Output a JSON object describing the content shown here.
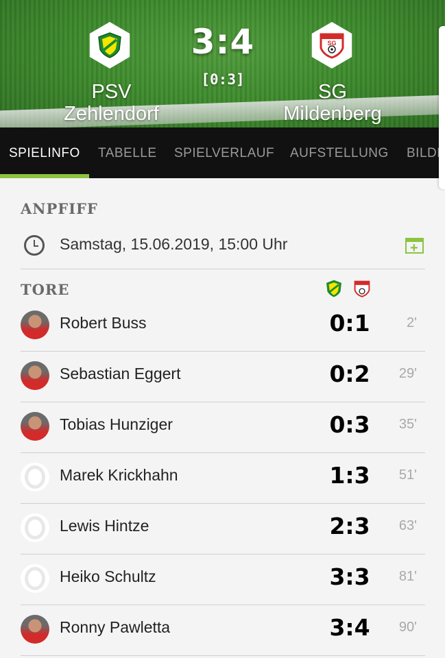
{
  "match": {
    "home_team": [
      "PSV",
      "Zehlendorf"
    ],
    "away_team": [
      "SG",
      "Mildenberg"
    ],
    "score": "3:4",
    "halftime": "[0:3]"
  },
  "tabs": [
    {
      "label": "SPIELINFO",
      "active": true
    },
    {
      "label": "TABELLE",
      "active": false
    },
    {
      "label": "SPIELVERLAUF",
      "active": false
    },
    {
      "label": "AUFSTELLUNG",
      "active": false
    },
    {
      "label": "BILDE",
      "active": false
    }
  ],
  "kickoff": {
    "title": "ANPFIFF",
    "datetime": "Samstag, 15.06.2019, 15:00 Uhr",
    "icon": "clock-icon",
    "action_icon": "calendar-add-icon"
  },
  "goals_section": {
    "title": "TORE",
    "goals": [
      {
        "player": "Robert Buss",
        "score": "0:1",
        "minute": "2'",
        "avatar": "photo"
      },
      {
        "player": "Sebastian Eggert",
        "score": "0:2",
        "minute": "29'",
        "avatar": "photo"
      },
      {
        "player": "Tobias Hunziger",
        "score": "0:3",
        "minute": "35'",
        "avatar": "photo"
      },
      {
        "player": "Marek Krickhahn",
        "score": "1:3",
        "minute": "51'",
        "avatar": "placeholder"
      },
      {
        "player": "Lewis Hintze",
        "score": "2:3",
        "minute": "63'",
        "avatar": "placeholder"
      },
      {
        "player": "Heiko Schultz",
        "score": "3:3",
        "minute": "81'",
        "avatar": "placeholder"
      },
      {
        "player": "Ronny Pawletta",
        "score": "3:4",
        "minute": "90'",
        "avatar": "photo"
      }
    ]
  },
  "colors": {
    "accent": "#8cc43f",
    "tabbar": "#111111",
    "away_red": "#d32a2a",
    "home_green": "#1f8a2e",
    "home_yellow": "#f3e600"
  }
}
